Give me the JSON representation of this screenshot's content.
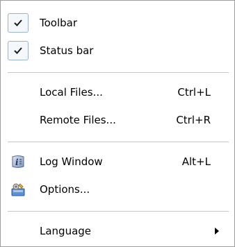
{
  "menu": {
    "toolbar": {
      "label": "Toolbar",
      "checked": true
    },
    "status_bar": {
      "label": "Status bar",
      "checked": true
    },
    "local_files": {
      "label": "Local Files...",
      "shortcut": "Ctrl+L"
    },
    "remote_files": {
      "label": "Remote Files...",
      "shortcut": "Ctrl+R"
    },
    "log_window": {
      "label": "Log Window",
      "shortcut": "Alt+L",
      "icon": "log-window-icon"
    },
    "options": {
      "label": "Options...",
      "icon": "options-icon"
    },
    "language": {
      "label": "Language",
      "submenu": true
    }
  },
  "colors": {
    "border": "#9d9d9d",
    "separator": "#c5c5c5",
    "check_border": "#9bb3cd"
  }
}
